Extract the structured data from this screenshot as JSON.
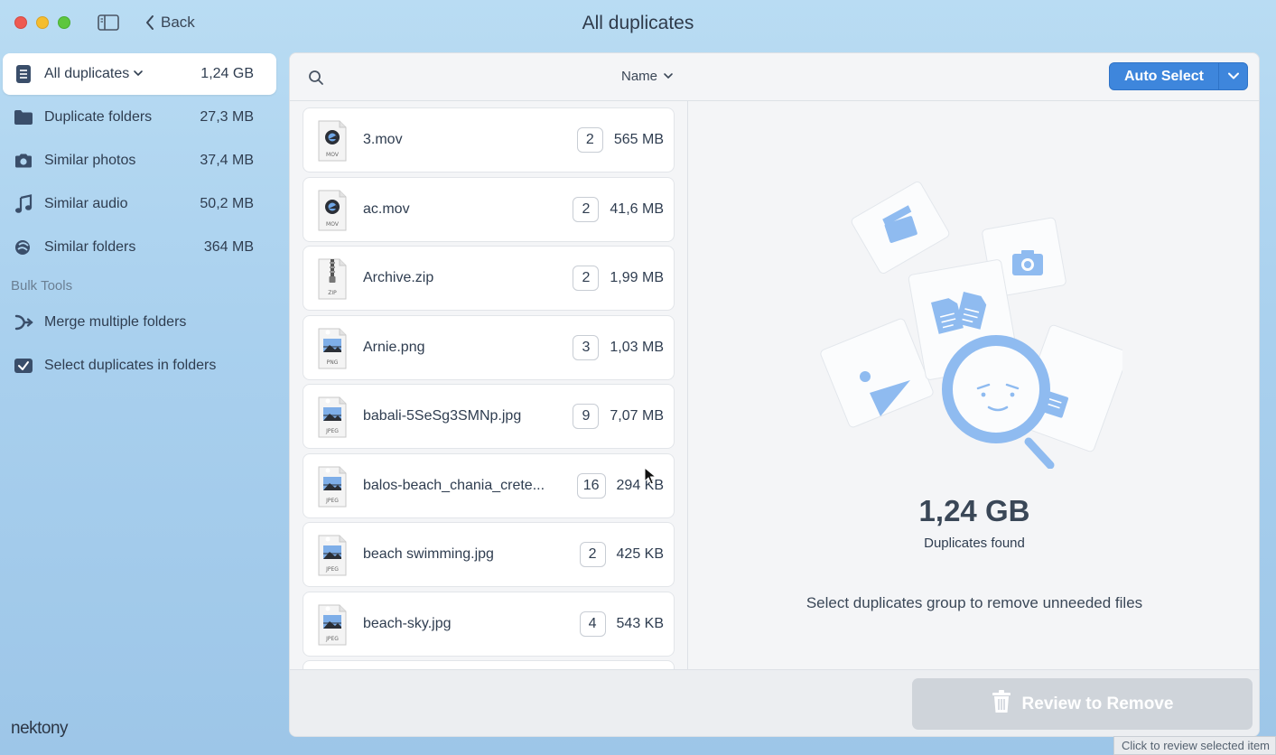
{
  "window": {
    "title": "All duplicates",
    "back_label": "Back"
  },
  "sidebar": {
    "items": [
      {
        "label": "All duplicates",
        "size": "1,24 GB",
        "icon": "list-icon",
        "active": true
      },
      {
        "label": "Duplicate folders",
        "size": "27,3 MB",
        "icon": "folder-icon"
      },
      {
        "label": "Similar photos",
        "size": "37,4 MB",
        "icon": "camera-icon"
      },
      {
        "label": "Similar audio",
        "size": "50,2 MB",
        "icon": "music-icon"
      },
      {
        "label": "Similar folders",
        "size": "364 MB",
        "icon": "similar-folders-icon"
      }
    ],
    "bulk_title": "Bulk Tools",
    "bulk_items": [
      {
        "label": "Merge multiple folders",
        "icon": "merge-icon"
      },
      {
        "label": "Select duplicates in folders",
        "icon": "checkbox-icon"
      }
    ]
  },
  "brand": "nektony",
  "list": {
    "sort_label": "Name",
    "rows": [
      {
        "name": "3.mov",
        "count": "2",
        "size": "565 MB",
        "type": "MOV"
      },
      {
        "name": "ac.mov",
        "count": "2",
        "size": "41,6 MB",
        "type": "MOV"
      },
      {
        "name": "Archive.zip",
        "count": "2",
        "size": "1,99 MB",
        "type": "ZIP"
      },
      {
        "name": "Arnie.png",
        "count": "3",
        "size": "1,03 MB",
        "type": "PNG"
      },
      {
        "name": "babali-5SeSg3SMNp.jpg",
        "count": "9",
        "size": "7,07 MB",
        "type": "JPEG"
      },
      {
        "name": "balos-beach_chania_crete...",
        "count": "16",
        "size": "294 KB",
        "type": "JPEG"
      },
      {
        "name": "beach swimming.jpg",
        "count": "2",
        "size": "425 KB",
        "type": "JPEG"
      },
      {
        "name": "beach-sky.jpg",
        "count": "4",
        "size": "543 KB",
        "type": "JPEG"
      }
    ]
  },
  "detail": {
    "auto_select_label": "Auto Select",
    "total_size": "1,24 GB",
    "found_label": "Duplicates found",
    "hint": "Select duplicates group to remove unneeded files",
    "review_label": "Review to Remove"
  },
  "tooltip": "Click to review selected item",
  "colors": {
    "accent": "#3e86dc",
    "illustration": "#8fbbf0",
    "disabled_button": "#cfd4da"
  }
}
